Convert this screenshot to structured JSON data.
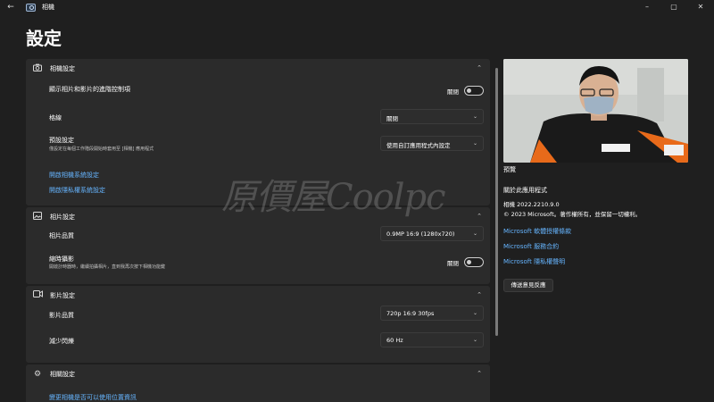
{
  "window": {
    "title": "相機",
    "back_icon": "back-arrow-icon",
    "minimize": "–",
    "maximize": "▢",
    "close": "✕"
  },
  "page": {
    "title": "設定"
  },
  "sections": {
    "camera": {
      "title": "相機設定",
      "icon": "camera-icon",
      "advanced_controls": {
        "label": "顯示相片和影片的進階控制項",
        "state": "關閉"
      },
      "grid": {
        "label": "格線",
        "value": "關閉"
      },
      "default_setting": {
        "label": "預設設定",
        "sub": "僅設定在每個工作階段開始時套用至 [相機] 應用程式",
        "value": "使用自訂應用程式內設定"
      },
      "link_system": "開啟相機系統設定",
      "link_privacy": "開啟隱私權系統設定"
    },
    "photo": {
      "title": "相片設定",
      "icon": "image-icon",
      "quality": {
        "label": "相片品質",
        "value": "0.9MP 16:9 (1280x720)"
      },
      "timelapse": {
        "label": "縮時攝影",
        "sub": "開啟計時器時，繼續拍攝相片，直到我再次按下相機功能鍵",
        "state": "關閉"
      }
    },
    "video": {
      "title": "影片設定",
      "icon": "video-icon",
      "quality": {
        "label": "影片品質",
        "value": "720p 16:9 30fps"
      },
      "flicker": {
        "label": "減少閃爍",
        "value": "60 Hz"
      }
    },
    "related": {
      "title": "相關設定",
      "icon": "gear-icon",
      "link": "變更相機是否可以使用位置資訊"
    }
  },
  "side": {
    "preview_label": "預覽",
    "about_title": "關於此應用程式",
    "version": "相機  2022.2210.9.0",
    "copyright": "© 2023 Microsoft。著作權所有，並保留一切權利。",
    "links": [
      "Microsoft 軟體授權條款",
      "Microsoft 服務合約",
      "Microsoft 隱私權聲明"
    ],
    "feedback_button": "傳送意見反應"
  },
  "watermark": "原價屋Coolpc",
  "colors": {
    "background": "#1f1f1f",
    "card": "#2b2b2b",
    "link": "#66b5ff"
  }
}
